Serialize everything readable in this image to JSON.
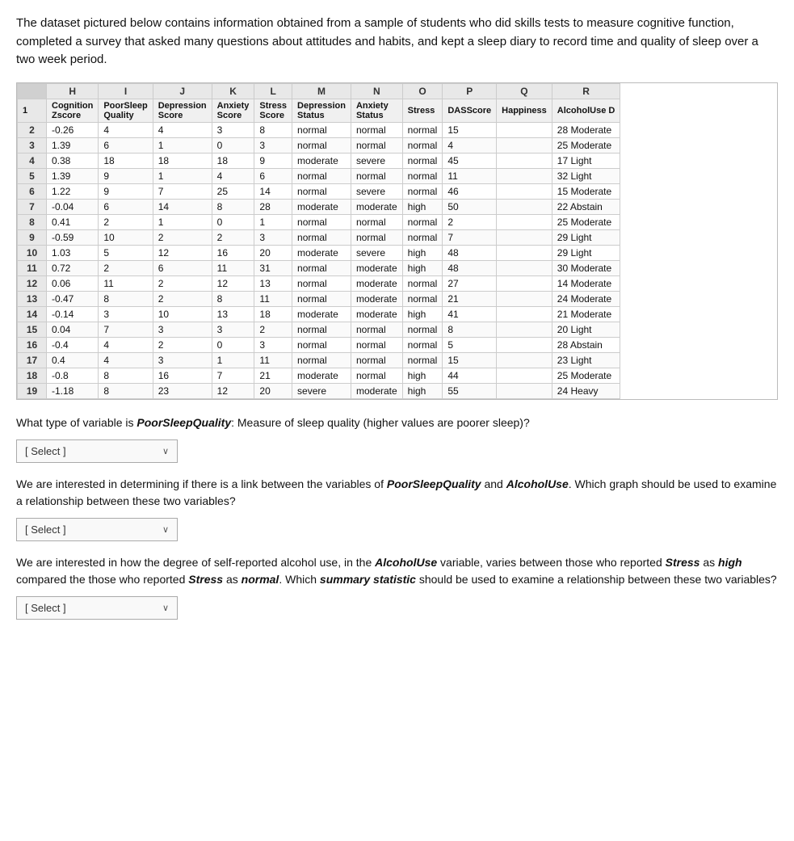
{
  "intro": {
    "text": "The dataset pictured below contains information obtained from a sample of students who did skills tests to measure cognitive function, completed a survey that asked many questions about attitudes and habits, and kept a sleep diary to record time and quality of sleep over a two week period."
  },
  "spreadsheet": {
    "col_letters": [
      "",
      "H",
      "I",
      "J",
      "K",
      "L",
      "M",
      "N",
      "O",
      "P",
      "Q",
      "R"
    ],
    "col_headers_row1": [
      "1",
      "Cognition Zscore",
      "PoorSleep Quality",
      "Depression Score",
      "Anxiety Score",
      "Stress Score",
      "Depression Status",
      "Anxiety Status",
      "Stress",
      "DASScore",
      "Happiness",
      "AlcoholUse D"
    ],
    "rows": [
      [
        "2",
        "-0.26",
        "4",
        "4",
        "3",
        "8",
        "normal",
        "normal",
        "normal",
        "15",
        "",
        "28 Moderate"
      ],
      [
        "3",
        "1.39",
        "6",
        "1",
        "0",
        "3",
        "normal",
        "normal",
        "normal",
        "4",
        "",
        "25 Moderate"
      ],
      [
        "4",
        "0.38",
        "18",
        "18",
        "18",
        "9",
        "moderate",
        "severe",
        "normal",
        "45",
        "",
        "17 Light"
      ],
      [
        "5",
        "1.39",
        "9",
        "1",
        "4",
        "6",
        "normal",
        "normal",
        "normal",
        "11",
        "",
        "32 Light"
      ],
      [
        "6",
        "1.22",
        "9",
        "7",
        "25",
        "14",
        "normal",
        "severe",
        "normal",
        "46",
        "",
        "15 Moderate"
      ],
      [
        "7",
        "-0.04",
        "6",
        "14",
        "8",
        "28",
        "moderate",
        "moderate",
        "high",
        "50",
        "",
        "22 Abstain"
      ],
      [
        "8",
        "0.41",
        "2",
        "1",
        "0",
        "1",
        "normal",
        "normal",
        "normal",
        "2",
        "",
        "25 Moderate"
      ],
      [
        "9",
        "-0.59",
        "10",
        "2",
        "2",
        "3",
        "normal",
        "normal",
        "normal",
        "7",
        "",
        "29 Light"
      ],
      [
        "10",
        "1.03",
        "5",
        "12",
        "16",
        "20",
        "moderate",
        "severe",
        "high",
        "48",
        "",
        "29 Light"
      ],
      [
        "11",
        "0.72",
        "2",
        "6",
        "11",
        "31",
        "normal",
        "moderate",
        "high",
        "48",
        "",
        "30 Moderate"
      ],
      [
        "12",
        "0.06",
        "11",
        "2",
        "12",
        "13",
        "normal",
        "moderate",
        "normal",
        "27",
        "",
        "14 Moderate"
      ],
      [
        "13",
        "-0.47",
        "8",
        "2",
        "8",
        "11",
        "normal",
        "moderate",
        "normal",
        "21",
        "",
        "24 Moderate"
      ],
      [
        "14",
        "-0.14",
        "3",
        "10",
        "13",
        "18",
        "moderate",
        "moderate",
        "high",
        "41",
        "",
        "21 Moderate"
      ],
      [
        "15",
        "0.04",
        "7",
        "3",
        "3",
        "2",
        "normal",
        "normal",
        "normal",
        "8",
        "",
        "20 Light"
      ],
      [
        "16",
        "-0.4",
        "4",
        "2",
        "0",
        "3",
        "normal",
        "normal",
        "normal",
        "5",
        "",
        "28 Abstain"
      ],
      [
        "17",
        "0.4",
        "4",
        "3",
        "1",
        "11",
        "normal",
        "normal",
        "normal",
        "15",
        "",
        "23 Light"
      ],
      [
        "18",
        "-0.8",
        "8",
        "16",
        "7",
        "21",
        "moderate",
        "normal",
        "high",
        "44",
        "",
        "25 Moderate"
      ],
      [
        "19",
        "-1.18",
        "8",
        "23",
        "12",
        "20",
        "severe",
        "moderate",
        "high",
        "55",
        "",
        "24 Heavy"
      ]
    ]
  },
  "questions": [
    {
      "id": "q1",
      "text_before": "What type of variable is ",
      "bold_italic": "PoorSleepQuality",
      "text_after": ": Measure of sleep quality (higher values are poorer sleep)?",
      "select_label": "[ Select ]"
    },
    {
      "id": "q2",
      "text_before": "We are interested in determining if there is a link between the variables of ",
      "bold_italic": "PoorSleepQuality",
      "text_mid": " and ",
      "bold_italic2": "AlcoholUse",
      "text_after": ". Which graph should be used to examine a relationship between these two variables?",
      "select_label": "[ Select ]"
    },
    {
      "id": "q3",
      "text_before": "We are interested in how the degree of self-reported alcohol use, in the ",
      "bold_italic": "AlcoholUse",
      "text_mid": " variable, varies between those who reported ",
      "bold_italic2": "Stress",
      "text_mid2": " as ",
      "bold_italic3": "high",
      "text_mid3": " compared the those who reported ",
      "bold_italic4": "Stress",
      "text_mid4": " as ",
      "bold_italic5": "normal",
      "text_after": ". Which ",
      "bold_italic6": "summary statistic",
      "text_after2": " should be used to examine a relationship between these two variables?",
      "select_label": "[ Select ]"
    }
  ]
}
